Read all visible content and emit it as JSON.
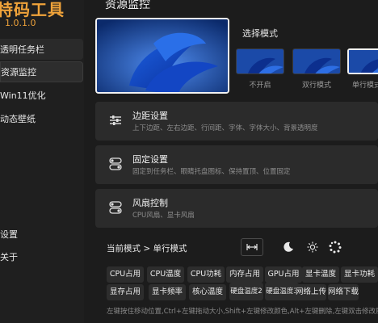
{
  "app": {
    "title": "特码工具",
    "version": "1.0.1.0"
  },
  "sidebar": {
    "items": [
      {
        "label": "透明任务栏"
      },
      {
        "label": "资源监控"
      },
      {
        "label": "Win11优化"
      },
      {
        "label": "动态壁纸"
      },
      {
        "label": "设置"
      },
      {
        "label": "关于"
      }
    ]
  },
  "page": {
    "title": "资源监控"
  },
  "mode_selector": {
    "label": "选择模式",
    "options": [
      {
        "label": "不开启"
      },
      {
        "label": "双行模式"
      },
      {
        "label": "单行模式"
      }
    ],
    "selected": "单行模式"
  },
  "settings": [
    {
      "title": "边距设置",
      "desc": "上下边距、左右边距、行间距、字体、字体大小、背景透明度",
      "icon": "sliders-icon"
    },
    {
      "title": "固定设置",
      "desc": "固定到任务栏、眼睛托盘图标、保持置顶、位置固定",
      "icon": "toggle-icon"
    },
    {
      "title": "风扇控制",
      "desc": "CPU风扇、显卡风扇",
      "icon": "toggle-icon"
    }
  ],
  "breadcrumb": "当前模式 > 单行模式",
  "toolbar": {
    "icons": [
      "expand-arrows-icon",
      "moon-icon",
      "sun-icon",
      "palette-icon"
    ]
  },
  "metrics": [
    "CPU占用",
    "CPU温度",
    "CPU功耗",
    "内存占用",
    "GPU占用",
    "显卡温度",
    "显卡功耗",
    "显存占用",
    "显卡频率",
    "核心温度",
    "硬盘温度2",
    "硬盘温度3",
    "网络上传",
    "网络下载"
  ],
  "hint": "左键按住移动位置,Ctrl+左键拖动大小,Shift+左键修改颜色,Alt+左键删除,左键双击修改展示"
}
